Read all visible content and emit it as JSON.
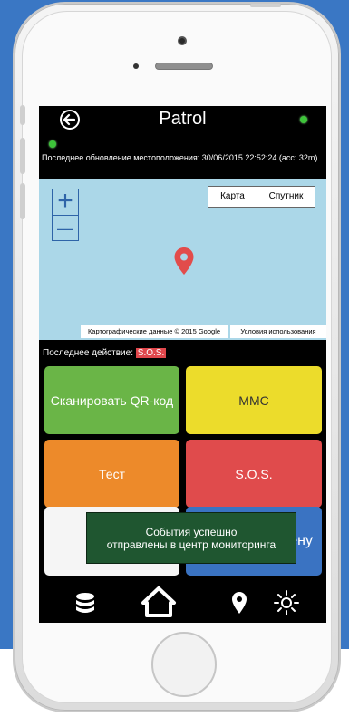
{
  "app": {
    "title": "Patrol",
    "last_location_update": "Последнее обновление местоположения: 30/06/2015 22:52:24 (acc: 32m)"
  },
  "map": {
    "zoom_in": "+",
    "zoom_out": "—",
    "map_type_options": [
      "Карта",
      "Спутник"
    ],
    "attribution": "Картографические данные © 2015 Google",
    "terms_link": "Условия использования"
  },
  "last_action": {
    "label": "Последнее действие:",
    "value": "S.O.S."
  },
  "tiles": [
    {
      "label": "Сканировать QR-код",
      "color": "#6ab547"
    },
    {
      "label": "MMC",
      "color": "#ecdc2b",
      "text_color": "#333333"
    },
    {
      "label": "Тест",
      "color": "#ed8a2a"
    },
    {
      "label": "S.O.S.",
      "color": "#e04b4c"
    },
    {
      "label": "",
      "color": "#f5f5f5"
    },
    {
      "label": "лену",
      "color": "#3a73c2"
    }
  ],
  "toast": {
    "line1": "События успешно",
    "line2": "отправлены в центр мониторинга"
  },
  "bottom_nav": [
    "database-icon",
    "home-icon",
    "location-pin-icon",
    "brightness-icon"
  ],
  "colors": {
    "background": "#3a77c4",
    "status_ok": "#3ec43a",
    "pin": "#e24c4b",
    "toast": "#1f5630"
  }
}
